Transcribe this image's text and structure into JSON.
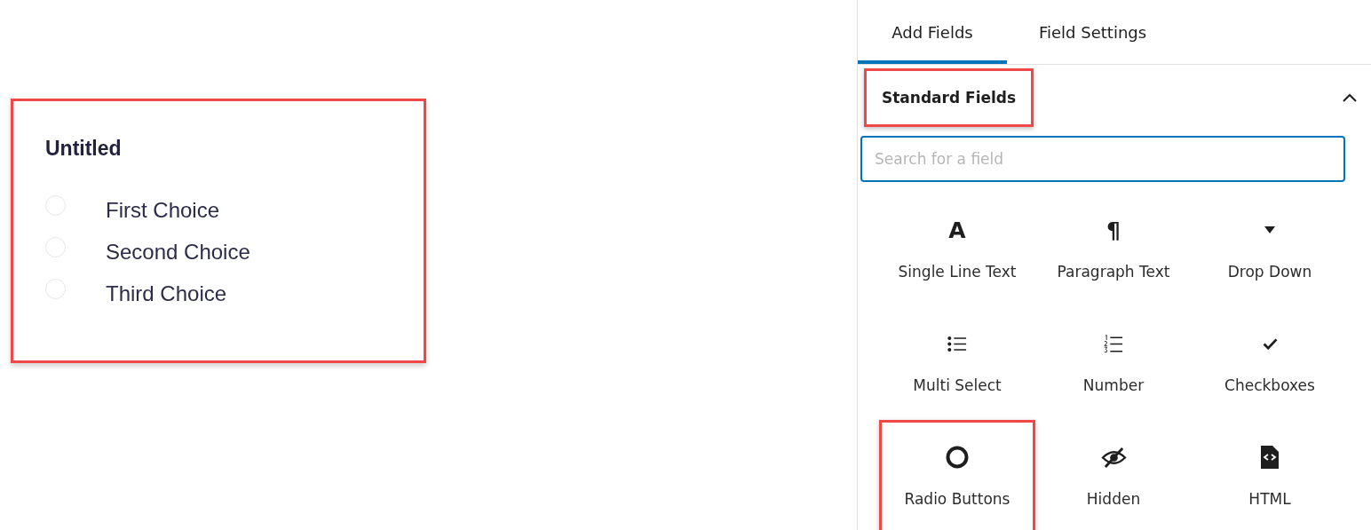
{
  "form_preview": {
    "highlighted": true,
    "title": "Untitled",
    "choices": [
      {
        "label": "First Choice",
        "selected": false
      },
      {
        "label": "Second Choice",
        "selected": false
      },
      {
        "label": "Third Choice",
        "selected": false
      }
    ]
  },
  "sidebar": {
    "tabs": [
      {
        "label": "Add Fields",
        "selected": true
      },
      {
        "label": "Field Settings",
        "selected": false
      }
    ],
    "section": {
      "title": "Standard Fields",
      "highlighted": true,
      "expanded": true
    },
    "search": {
      "placeholder": "Search for a field"
    },
    "fields": [
      {
        "label": "Single Line Text",
        "kind": "char",
        "glyph": "A",
        "highlighted": false
      },
      {
        "label": "Paragraph Text",
        "kind": "char",
        "glyph": "¶",
        "highlighted": false
      },
      {
        "label": "Drop Down",
        "kind": "caret",
        "highlighted": false
      },
      {
        "label": "Multi Select",
        "kind": "bullets",
        "highlighted": false
      },
      {
        "label": "Number",
        "kind": "numbers",
        "highlighted": false
      },
      {
        "label": "Checkboxes",
        "kind": "check",
        "highlighted": false
      },
      {
        "label": "Radio Buttons",
        "kind": "radio",
        "highlighted": true
      },
      {
        "label": "Hidden",
        "kind": "eye-slash",
        "highlighted": false
      },
      {
        "label": "HTML",
        "kind": "code-file",
        "highlighted": false
      }
    ]
  }
}
